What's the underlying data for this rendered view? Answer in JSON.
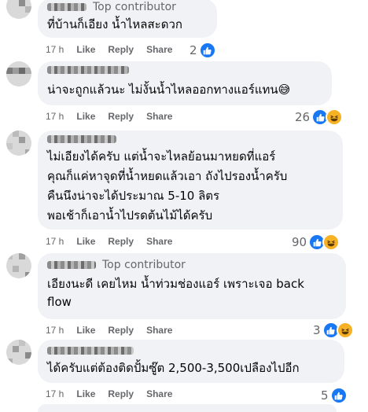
{
  "comments": [
    {
      "badge": "Top contributor",
      "text_lines": [
        "ที่บ้านก็เอียง น้ำไหลสะดวก"
      ],
      "time": "17 h",
      "actions": [
        "Like",
        "Reply",
        "Share"
      ],
      "reaction_count": "2",
      "reactions": [
        "like-icon"
      ]
    },
    {
      "badge": "",
      "text_lines": [
        "น่าจะถูกแล้วนะ ไม่งั้นน้ำไหลออกทางแอร์แทน😅"
      ],
      "time": "17 h",
      "actions": [
        "Like",
        "Reply",
        "Share"
      ],
      "reaction_count": "26",
      "reactions": [
        "like-icon",
        "haha-icon"
      ]
    },
    {
      "badge": "",
      "text_lines": [
        "ไม่เอียงได้ครับ แต่น้ำจะไหลย้อนมาหยดที่แอร์",
        "คุณก็แค่หาจุดที่น้ำหยดแล้วเอา ถังไปรองน้ำครับ",
        "คืนนึงน่าจะได้ประมาณ 5-10 ลิตร",
        "พอเช้าก็เอาน้ำไปรดต้นไม้ได้ครับ"
      ],
      "time": "17 h",
      "actions": [
        "Like",
        "Reply",
        "Share"
      ],
      "reaction_count": "90",
      "reactions": [
        "like-icon",
        "haha-icon"
      ]
    },
    {
      "badge": "Top contributor",
      "text_lines": [
        "เอียงนะดี เคยไหม น้ำท่วมช่องแอร์ เพราะเจอ back",
        "flow"
      ],
      "time": "17 h",
      "actions": [
        "Like",
        "Reply",
        "Share"
      ],
      "reaction_count": "3",
      "reactions": [
        "like-icon",
        "haha-icon"
      ]
    },
    {
      "badge": "",
      "text_lines": [
        "ได้ครับแต่ต้องติดปั้มซู๊ต 2,500-3,500เปลืองไปอีก"
      ],
      "time": "17 h",
      "actions": [
        "Like",
        "Reply",
        "Share"
      ],
      "reaction_count": "5",
      "reactions": [
        "like-icon"
      ]
    }
  ],
  "colors": {
    "bubble": "#f0f2f5",
    "secondary_text": "#65676b",
    "like": "#1877f2",
    "haha": "#f7b125"
  }
}
